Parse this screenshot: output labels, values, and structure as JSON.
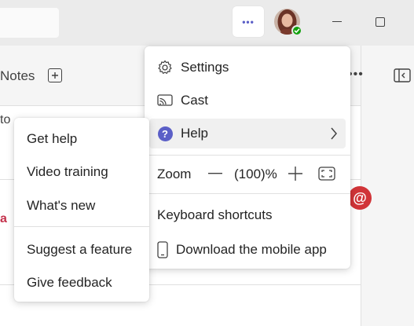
{
  "titlebar": {
    "more_label": "•••",
    "accent": "#5b5fc7",
    "presence_color": "#13a10e"
  },
  "tabs": {
    "notes_label": "Notes",
    "more_label": "•••"
  },
  "background": {
    "line1": "to",
    "line2": "a",
    "mention_symbol": "@"
  },
  "menu": {
    "settings_label": "Settings",
    "cast_label": "Cast",
    "help_label": "Help",
    "help_icon_glyph": "?",
    "zoom_label": "Zoom",
    "zoom_value": "(100)%",
    "keyboard_label": "Keyboard shortcuts",
    "mobile_label": "Download the mobile app"
  },
  "help_submenu": {
    "items": [
      "Get help",
      "Video training",
      "What's new",
      "Suggest a feature",
      "Give feedback"
    ]
  }
}
